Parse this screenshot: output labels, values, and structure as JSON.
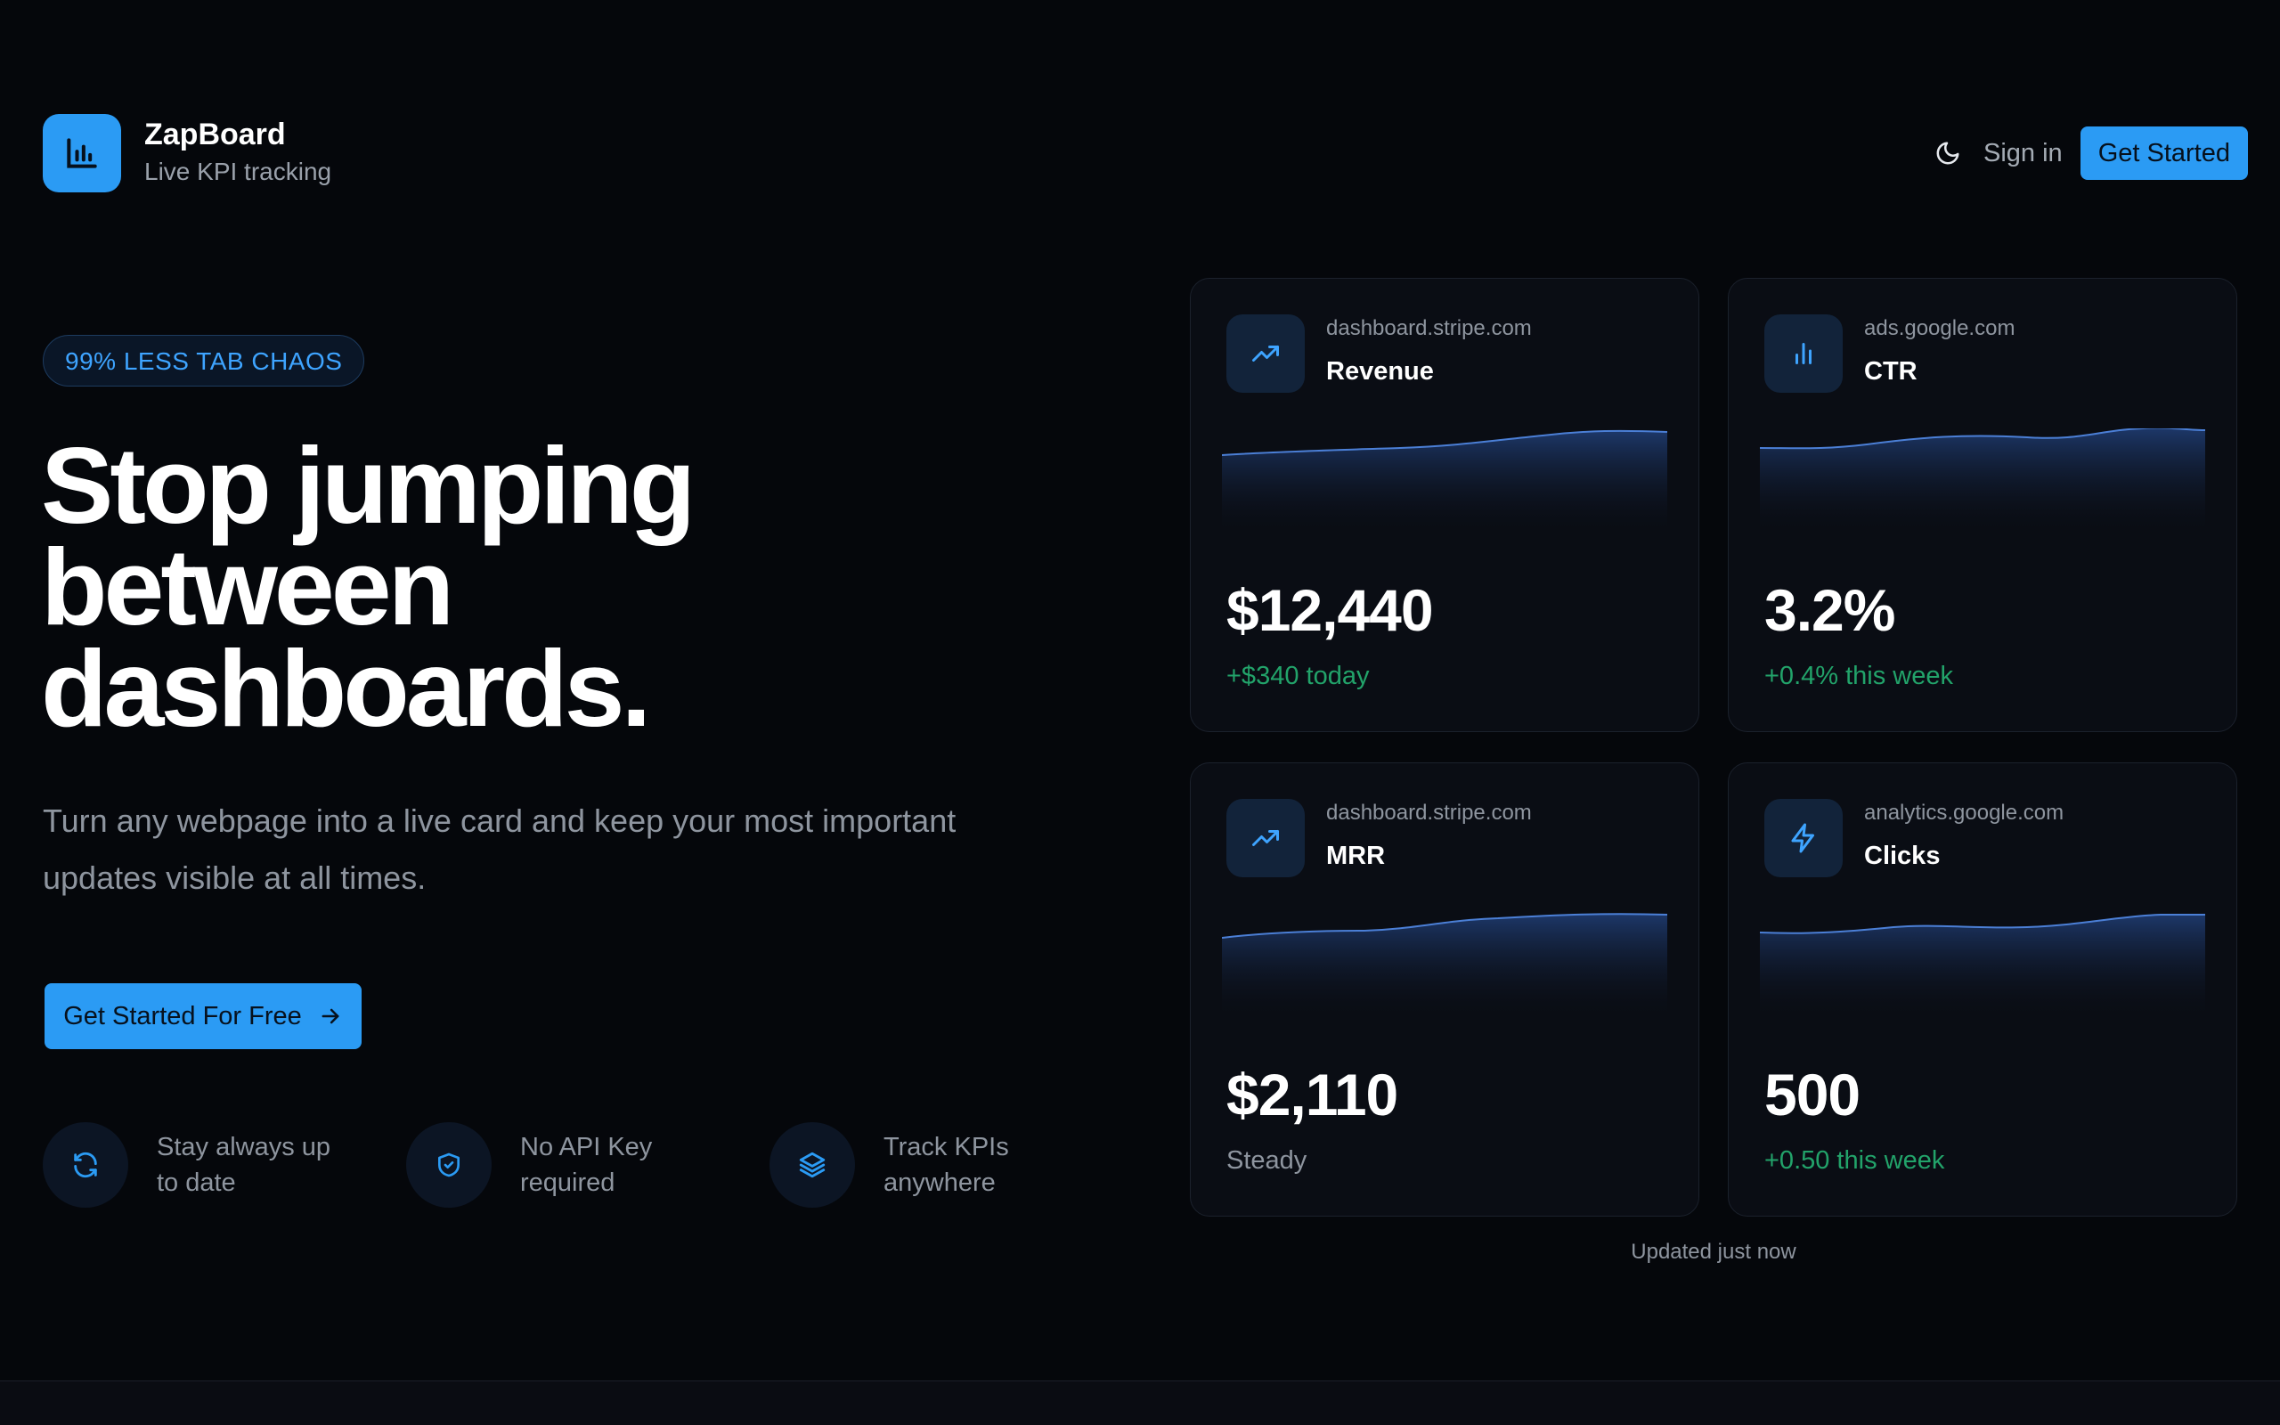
{
  "brand": {
    "name": "ZapBoard",
    "tagline": "Live KPI tracking"
  },
  "nav": {
    "signin_label": "Sign in",
    "get_started_label": "Get Started"
  },
  "hero": {
    "badge": "99% LESS TAB CHAOS",
    "headline_line1": "Stop jumping",
    "headline_line2": "between",
    "headline_line3": "dashboards.",
    "subtext": "Turn any webpage into a live card and keep your most important updates visible at all times.",
    "cta_label": "Get Started For Free"
  },
  "features": [
    {
      "icon": "refresh-icon",
      "line1": "Stay always up",
      "line2": "to date"
    },
    {
      "icon": "shield-check-icon",
      "line1": "No API Key",
      "line2": "required"
    },
    {
      "icon": "layers-icon",
      "line1": "Track KPIs",
      "line2": "anywhere"
    }
  ],
  "cards": [
    {
      "icon": "trending-up-icon",
      "source": "dashboard.stripe.com",
      "title": "Revenue",
      "value": "$12,440",
      "delta": "+$340 today",
      "delta_status": "positive"
    },
    {
      "icon": "bar-chart-icon",
      "source": "ads.google.com",
      "title": "CTR",
      "value": "3.2%",
      "delta": "+0.4% this week",
      "delta_status": "positive"
    },
    {
      "icon": "trending-up-icon",
      "source": "dashboard.stripe.com",
      "title": "MRR",
      "value": "$2,110",
      "delta": "Steady",
      "delta_status": "neutral"
    },
    {
      "icon": "zap-icon",
      "source": "analytics.google.com",
      "title": "Clicks",
      "value": "500",
      "delta": "+0.50 this week",
      "delta_status": "positive"
    }
  ],
  "updated_text": "Updated just now",
  "colors": {
    "accent": "#2b9bf4",
    "background": "#05070b",
    "card_background": "#0a0d14",
    "positive": "#22a36a",
    "muted_text": "#8e959f"
  }
}
